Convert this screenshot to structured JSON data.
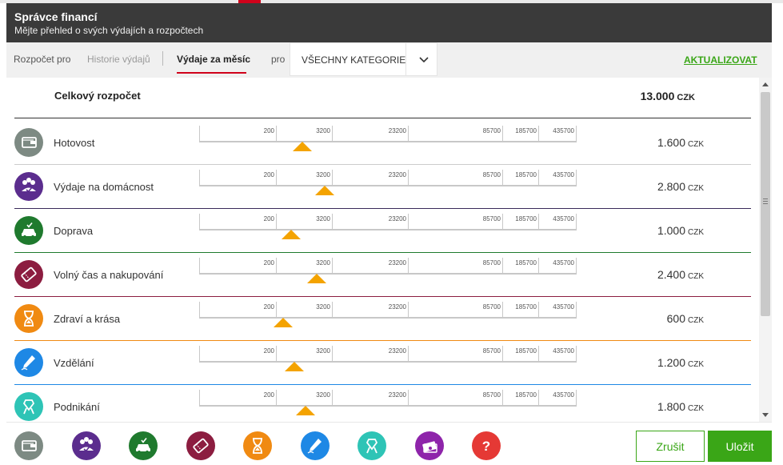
{
  "header": {
    "title": "Správce financí",
    "subtitle": "Mějte přehled o svých výdajích a rozpočtech"
  },
  "tabs": {
    "budget_label": "Rozpočet pro",
    "history_label": "Historie výdajů",
    "monthly_label": "Výdaje za měsíc",
    "pro_label": "pro",
    "category_value": "VŠECHNY KATEGORIE",
    "refresh_label": "AKTUALIZOVAT"
  },
  "total": {
    "label": "Celkový rozpočet",
    "value": "13.000",
    "currency": "CZK"
  },
  "scale": {
    "ticks": [
      "200",
      "3200",
      "23200",
      "85700",
      "185700",
      "435700"
    ]
  },
  "categories": [
    {
      "label": "Hotovost",
      "amount": "1.600",
      "currency": "CZK",
      "color": "#7d8a83",
      "icon": "wallet-icon",
      "divider": "#cccccc",
      "slider_value": 1600
    },
    {
      "label": "Výdaje na domácnost",
      "amount": "2.800",
      "currency": "CZK",
      "color": "#5b2d8e",
      "icon": "household-icon",
      "divider": "#3a2a5a",
      "slider_value": 2800
    },
    {
      "label": "Doprava",
      "amount": "1.000",
      "currency": "CZK",
      "color": "#1f7a2e",
      "icon": "car-icon",
      "divider": "#1f7a2e",
      "slider_value": 1000
    },
    {
      "label": "Volný čas a nakupování",
      "amount": "2.400",
      "currency": "CZK",
      "color": "#8c1d40",
      "icon": "ticket-icon",
      "divider": "#8c1d40",
      "slider_value": 2400
    },
    {
      "label": "Zdraví a krása",
      "amount": "600",
      "currency": "CZK",
      "color": "#f08a12",
      "icon": "hourglass-icon",
      "divider": "#f08a12",
      "slider_value": 600
    },
    {
      "label": "Vzdělání",
      "amount": "1.200",
      "currency": "CZK",
      "color": "#1e88e5",
      "icon": "pen-icon",
      "divider": "#1e88e5",
      "slider_value": 1200
    },
    {
      "label": "Podnikání",
      "amount": "1.800",
      "currency": "CZK",
      "color": "#2ec4b6",
      "icon": "ribbon-icon",
      "divider": "#2ec4b6",
      "slider_value": 1800
    }
  ],
  "footer": {
    "icons": [
      {
        "name": "wallet-icon",
        "color": "#7d8a83"
      },
      {
        "name": "household-icon",
        "color": "#5b2d8e"
      },
      {
        "name": "car-icon",
        "color": "#1f7a2e"
      },
      {
        "name": "ticket-icon",
        "color": "#8c1d40"
      },
      {
        "name": "hourglass-icon",
        "color": "#f08a12"
      },
      {
        "name": "pen-icon",
        "color": "#1e88e5"
      },
      {
        "name": "ribbon-icon",
        "color": "#2ec4b6"
      },
      {
        "name": "money-icon",
        "color": "#8e24aa"
      },
      {
        "name": "question-icon",
        "color": "#e53935",
        "glyph": "?"
      }
    ],
    "cancel_label": "Zrušit",
    "save_label": "Uložit"
  },
  "colors": {
    "accent_green": "#3aa617",
    "slider_thumb": "#f4a300",
    "tab_underline": "#d0021b",
    "header_bg": "#3a3a3a"
  }
}
